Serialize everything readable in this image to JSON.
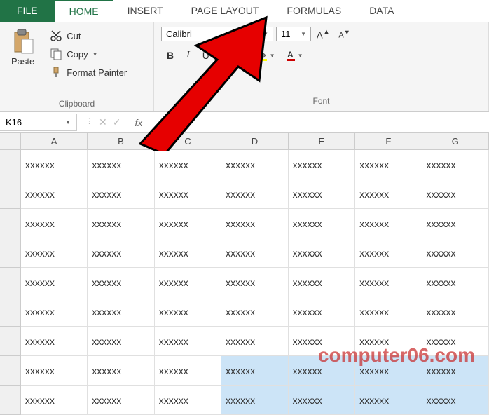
{
  "tabs": {
    "file": "FILE",
    "home": "HOME",
    "insert": "INSERT",
    "page_layout": "PAGE LAYOUT",
    "formulas": "FORMULAS",
    "data": "DATA"
  },
  "ribbon": {
    "clipboard": {
      "paste": "Paste",
      "cut": "Cut",
      "copy": "Copy",
      "format_painter": "Format Painter",
      "group_label": "Clipboard"
    },
    "font": {
      "font_name": "Calibri",
      "font_size": "11",
      "grow": "A",
      "shrink": "A",
      "bold": "B",
      "italic": "I",
      "underline": "U",
      "group_label": "Font"
    }
  },
  "formula_bar": {
    "name_box": "K16",
    "fx": "fx"
  },
  "grid": {
    "columns": [
      "A",
      "B",
      "C",
      "D",
      "E",
      "F",
      "G"
    ],
    "row_count": 9,
    "cell_value": "xxxxxx",
    "selected_rows": [
      8,
      9
    ],
    "selected_cols_from": 3
  },
  "watermark": "computer06.com"
}
